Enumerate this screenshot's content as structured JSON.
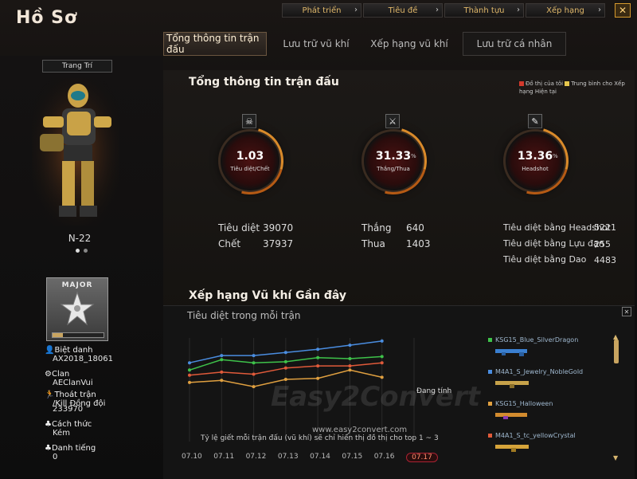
{
  "app": {
    "title": "Hồ Sơ"
  },
  "topnav": [
    {
      "label": "Phát triển"
    },
    {
      "label": "Tiêu đề"
    },
    {
      "label": "Thành tựu"
    },
    {
      "label": "Xếp hạng"
    }
  ],
  "close_label": "✕",
  "tabs": [
    {
      "label": "Tổng thông tin trận đấu"
    },
    {
      "label": "Lưu trữ vũ khí"
    },
    {
      "label": "Xếp hạng vũ khí"
    },
    {
      "label": "Lưu trữ cá nhân"
    }
  ],
  "left": {
    "decor_button": "Trang Trí",
    "character_name": "N-22",
    "rank_title": "MAJOR",
    "nickname_label": "Biệt danh",
    "nickname_value": "AX2018_18061",
    "clan_label": "Clan",
    "clan_value": "AEClanVui",
    "escape_label": "Thoát trận",
    "escape_label2": "/Kill Đồng đội",
    "escape_value": "233970",
    "play_label": "Cách thức",
    "play_value": "Kém",
    "reputation_label": "Danh tiếng",
    "reputation_value": "0"
  },
  "summary": {
    "title": "Tổng thông tin trận đấu",
    "legend_mine": "Đồ thị của tôi",
    "legend_avg": "Trung bình cho Xếp hạng Hiện tại",
    "legend_mine_color": "#d2392c",
    "legend_avg_color": "#e5c64d",
    "gauges": [
      {
        "value": "1.03",
        "unit": "",
        "label": "Tiêu diệt/Chết",
        "icon": "skull-icon",
        "glyph": "☠"
      },
      {
        "value": "31.33",
        "unit": "%",
        "label": "Thắng/Thua",
        "icon": "crossed-swords-icon",
        "glyph": "⚔"
      },
      {
        "value": "13.36",
        "unit": "%",
        "label": "Headshot",
        "icon": "knife-icon",
        "glyph": "✎"
      }
    ],
    "kills_label": "Tiêu diệt",
    "kills_value": "39070",
    "deaths_label": "Chết",
    "deaths_value": "37937",
    "wins_label": "Thắng",
    "wins_value": "640",
    "losses_label": "Thua",
    "losses_value": "1403",
    "hs_label": "Tiêu diệt bằng Headshot",
    "hs_value": "5221",
    "grenade_label": "Tiêu diệt bằng Lựu đạn",
    "grenade_value": "255",
    "knife_label": "Tiêu diệt bằng Dao",
    "knife_value": "4483"
  },
  "weapons_section": {
    "title": "Xếp hạng Vũ khí Gần đây",
    "subtitle": "Tiêu diệt trong mỗi trận",
    "calc_label": "Đang tính",
    "note": "Tỷ lệ giết mỗi trận đấu (vũ khí) sẽ chỉ hiển thị đồ thị cho top 1 ~ 3",
    "close_label": "✕",
    "weapons": [
      {
        "name": "KSG15_Blue_SilverDragon",
        "color": "#3ec24a",
        "gun_color": "#3a7fd0"
      },
      {
        "name": "M4A1_S_Jewelry_NobleGold",
        "color": "#4a8de0",
        "gun_color": "#c7a24a"
      },
      {
        "name": "KSG15_Halloween",
        "color": "#e0a040",
        "gun_color": "#d28b2e"
      },
      {
        "name": "M4A1_S_tc_yellowCrystal",
        "color": "#e05a3a",
        "gun_color": "#d6a43a"
      }
    ]
  },
  "chart_data": {
    "type": "line",
    "title": "Tiêu diệt trong mỗi trận",
    "categories": [
      "07.10",
      "07.11",
      "07.12",
      "07.13",
      "07.14",
      "07.15",
      "07.16",
      "07.17"
    ],
    "highlighted_category": "07.17",
    "grid": true,
    "series": [
      {
        "name": "KSG15_Blue_SilverDragon",
        "color": "#3ec24a",
        "values": [
          0.69,
          0.79,
          0.76,
          0.77,
          0.81,
          0.8,
          0.82,
          null
        ]
      },
      {
        "name": "M4A1_S_Jewelry_NobleGold",
        "color": "#4a8de0",
        "values": [
          0.76,
          0.83,
          0.83,
          0.86,
          0.89,
          0.93,
          0.97,
          null
        ]
      },
      {
        "name": "KSG15_Halloween",
        "color": "#e0a040",
        "values": [
          0.57,
          0.59,
          0.53,
          0.6,
          0.61,
          0.69,
          0.62,
          null
        ]
      },
      {
        "name": "M4A1_S_tc_yellowCrystal",
        "color": "#e05a3a",
        "values": [
          0.64,
          0.67,
          0.65,
          0.71,
          0.73,
          0.73,
          0.76,
          null
        ]
      }
    ]
  },
  "watermark": {
    "site": "www.easy2convert.com",
    "brand": "Easy2Convert"
  }
}
